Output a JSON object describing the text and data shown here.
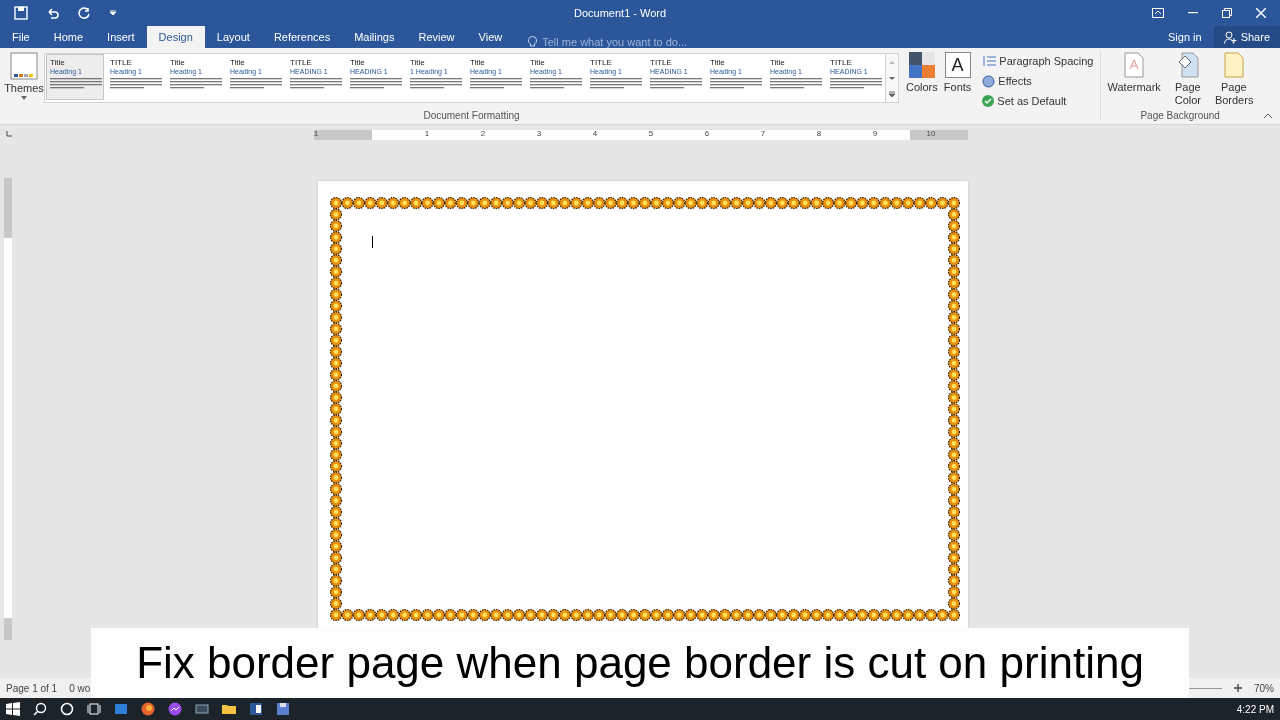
{
  "window": {
    "title": "Document1 - Word"
  },
  "tabs": [
    {
      "label": "File",
      "selected": false
    },
    {
      "label": "Home",
      "selected": false
    },
    {
      "label": "Insert",
      "selected": false
    },
    {
      "label": "Design",
      "selected": true
    },
    {
      "label": "Layout",
      "selected": false
    },
    {
      "label": "References",
      "selected": false
    },
    {
      "label": "Mailings",
      "selected": false
    },
    {
      "label": "Review",
      "selected": false
    },
    {
      "label": "View",
      "selected": false
    }
  ],
  "tell_me": {
    "placeholder": "Tell me what you want to do..."
  },
  "account": {
    "sign_in": "Sign in",
    "share": "Share"
  },
  "ribbon": {
    "themes": "Themes",
    "style_gallery": [
      {
        "title": "Title",
        "heading": "Heading 1",
        "selected": true
      },
      {
        "title": "TITLE",
        "heading": "Heading 1",
        "selected": false
      },
      {
        "title": "Title",
        "heading": "Heading 1",
        "selected": false
      },
      {
        "title": "Title",
        "heading": "Heading 1",
        "selected": false
      },
      {
        "title": "TITLE",
        "heading": "HEADING 1",
        "selected": false
      },
      {
        "title": "Title",
        "heading": "HEADING 1",
        "selected": false
      },
      {
        "title": "Title",
        "heading": "1 Heading 1",
        "selected": false
      },
      {
        "title": "Title",
        "heading": "Heading 1",
        "selected": false
      },
      {
        "title": "Title",
        "heading": "Heading 1",
        "selected": false
      },
      {
        "title": "TITLE",
        "heading": "Heading 1",
        "selected": false
      },
      {
        "title": "TITLE",
        "heading": "HEADING 1",
        "selected": false
      },
      {
        "title": "Title",
        "heading": "Heading 1",
        "selected": false
      },
      {
        "title": "Title",
        "heading": "Heading 1",
        "selected": false
      },
      {
        "title": "TITLE",
        "heading": "HEADING 1",
        "selected": false
      }
    ],
    "document_formatting_label": "Document Formatting",
    "colors": "Colors",
    "fonts_glyph": "A",
    "fonts": "Fonts",
    "paragraph_spacing": "Paragraph Spacing",
    "effects": "Effects",
    "set_as_default": "Set as Default",
    "watermark": "Watermark",
    "page_color": "Page Color",
    "page_borders": "Page Borders",
    "page_background_label": "Page Background"
  },
  "ruler": [
    "1",
    "1",
    "2",
    "3",
    "4",
    "5",
    "6",
    "7",
    "8",
    "9",
    "10"
  ],
  "status_bar": {
    "page": "Page 1 of 1",
    "words": "0 wo",
    "zoom": "70%"
  },
  "caption": "Fix border page when page border is cut on printing",
  "taskbar": {
    "time": "4:22 PM"
  }
}
